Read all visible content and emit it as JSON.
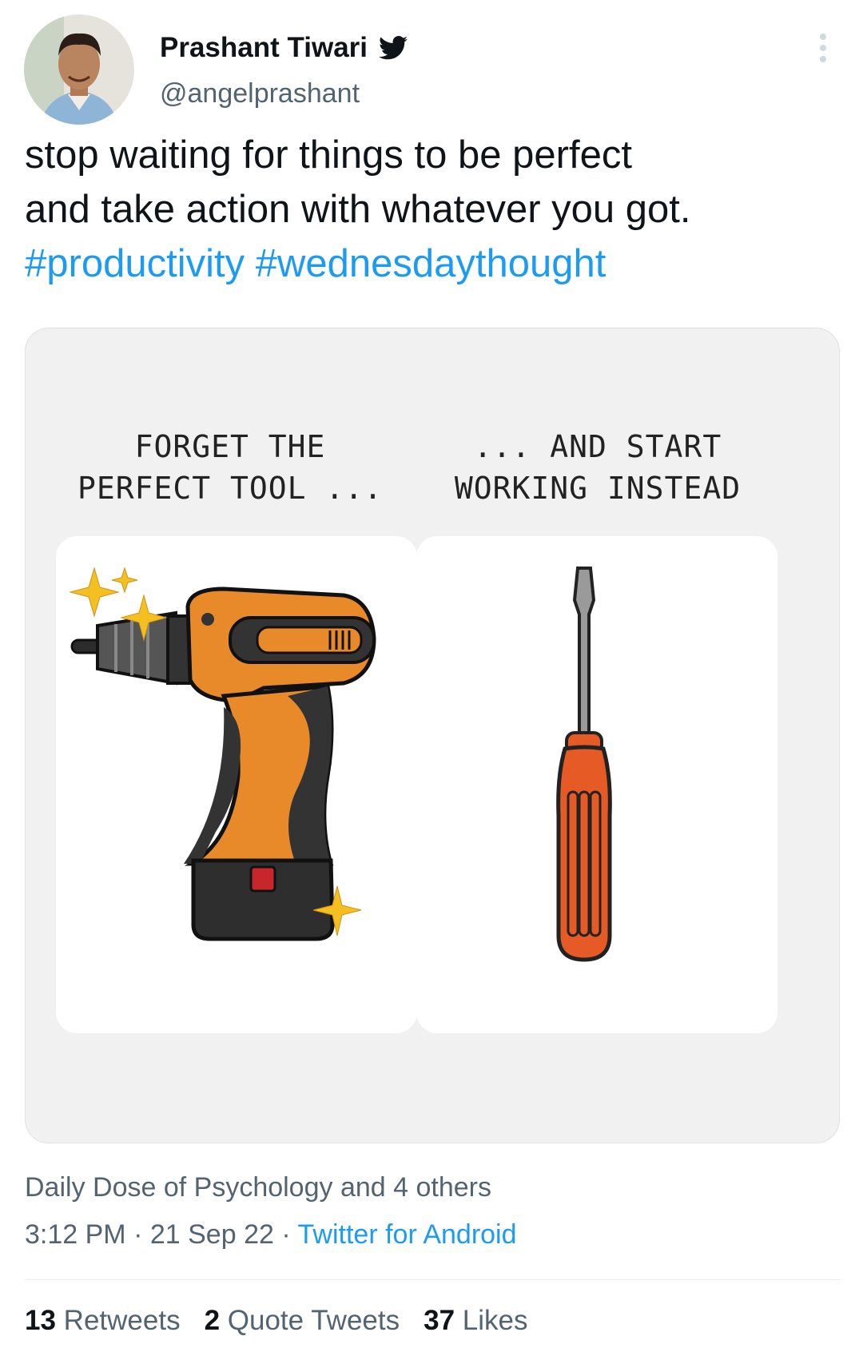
{
  "author": {
    "name": "Prashant Tiwari",
    "handle": "@angelprashant"
  },
  "tweet": {
    "text_line1": "stop waiting for things to be perfect",
    "text_line2": "and take action with whatever you got.",
    "hashtags": [
      "#productivity",
      "#wednesdaythought"
    ]
  },
  "media": {
    "left_caption": "FORGET THE\nPERFECT TOOL ...",
    "right_caption": "... AND START\nWORKING INSTEAD"
  },
  "meta": {
    "liked_by": "Daily Dose of Psychology and 4 others",
    "time": "3:12 PM",
    "date": "21 Sep 22",
    "separator": "·",
    "source": "Twitter for Android"
  },
  "stats": [
    {
      "count": "13",
      "label": "Retweets"
    },
    {
      "count": "2",
      "label": "Quote Tweets"
    },
    {
      "count": "37",
      "label": "Likes"
    }
  ],
  "colors": {
    "link": "#1d9bf0",
    "secondary_text": "#536471",
    "drill_orange": "#e98a2a",
    "screwdriver_handle": "#e65a25"
  }
}
